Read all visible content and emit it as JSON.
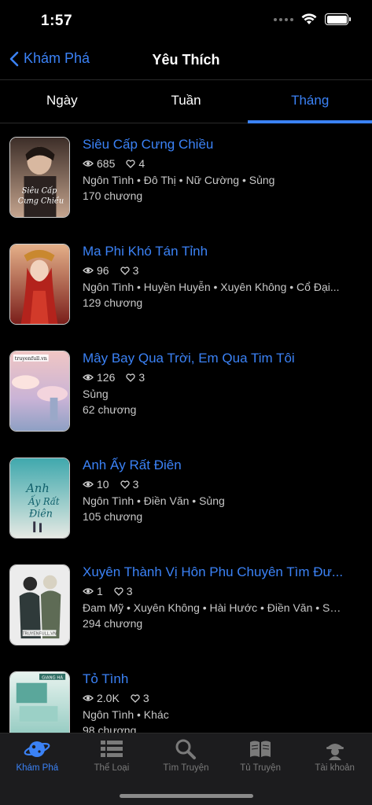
{
  "status": {
    "time": "1:57"
  },
  "nav": {
    "back_label": "Khám Phá",
    "title": "Yêu Thích"
  },
  "tabs": [
    {
      "label": "Ngày",
      "active": false
    },
    {
      "label": "Tuần",
      "active": false
    },
    {
      "label": "Tháng",
      "active": true
    }
  ],
  "stories": [
    {
      "title": "Siêu Cấp Cưng Chiều",
      "views": "685",
      "likes": "4",
      "genres": "Ngôn Tình • Đô Thị • Nữ Cường • Sủng",
      "chapters": "170 chương",
      "cover_colors": [
        "#4a3a32",
        "#b08f78"
      ],
      "cover_text": "Siêu Cấp Cưng Chiều"
    },
    {
      "title": "Ma Phi Khó Tán Tỉnh",
      "views": "96",
      "likes": "3",
      "genres": "Ngôn Tình • Huyền Huyễn • Xuyên Không • Cổ Đại...",
      "chapters": "129 chương",
      "cover_colors": [
        "#7a1e1a",
        "#d9a078"
      ],
      "cover_text": ""
    },
    {
      "title": "Mây Bay Qua Trời, Em Qua Tim Tôi",
      "views": "126",
      "likes": "3",
      "genres": "Sủng",
      "chapters": "62 chương",
      "cover_colors": [
        "#e8b4b8",
        "#b9a6c9"
      ],
      "cover_text": "truyenfull.vn"
    },
    {
      "title": "Anh Ấy Rất Điên",
      "views": "10",
      "likes": "3",
      "genres": "Ngôn Tình • Điền Văn • Sủng",
      "chapters": "105 chương",
      "cover_colors": [
        "#4fb3b3",
        "#d9e3e0"
      ],
      "cover_text": "Anh Ấy Rất Điên"
    },
    {
      "title": "Xuyên Thành Vị Hôn Phu Chuyên Tìm Đư...",
      "views": "1",
      "likes": "3",
      "genres": "Đam Mỹ • Xuyên Không • Hài Hước • Điền Văn • Sủ...",
      "chapters": "294 chương",
      "cover_colors": [
        "#e9e9e9",
        "#5a6a5a"
      ],
      "cover_text": "TRUYENFULL.VN"
    },
    {
      "title": "Tỏ Tình",
      "views": "2.0K",
      "likes": "3",
      "genres": "Ngôn Tình • Khác",
      "chapters": "98 chương",
      "cover_colors": [
        "#9fd4cc",
        "#e6f2ee"
      ],
      "cover_text": "GIANG HÀ"
    }
  ],
  "tab_bar": [
    {
      "label": "Khám Phá",
      "icon": "planet-icon",
      "active": true
    },
    {
      "label": "Thể Loại",
      "icon": "list-icon",
      "active": false
    },
    {
      "label": "Tìm Truyện",
      "icon": "search-icon",
      "active": false
    },
    {
      "label": "Tủ Truyện",
      "icon": "book-icon",
      "active": false
    },
    {
      "label": "Tài khoản",
      "icon": "account-icon",
      "active": false
    }
  ],
  "colors": {
    "accent": "#3b82f6",
    "background": "#000000",
    "tab_bar_bg": "#1c1c1e"
  }
}
